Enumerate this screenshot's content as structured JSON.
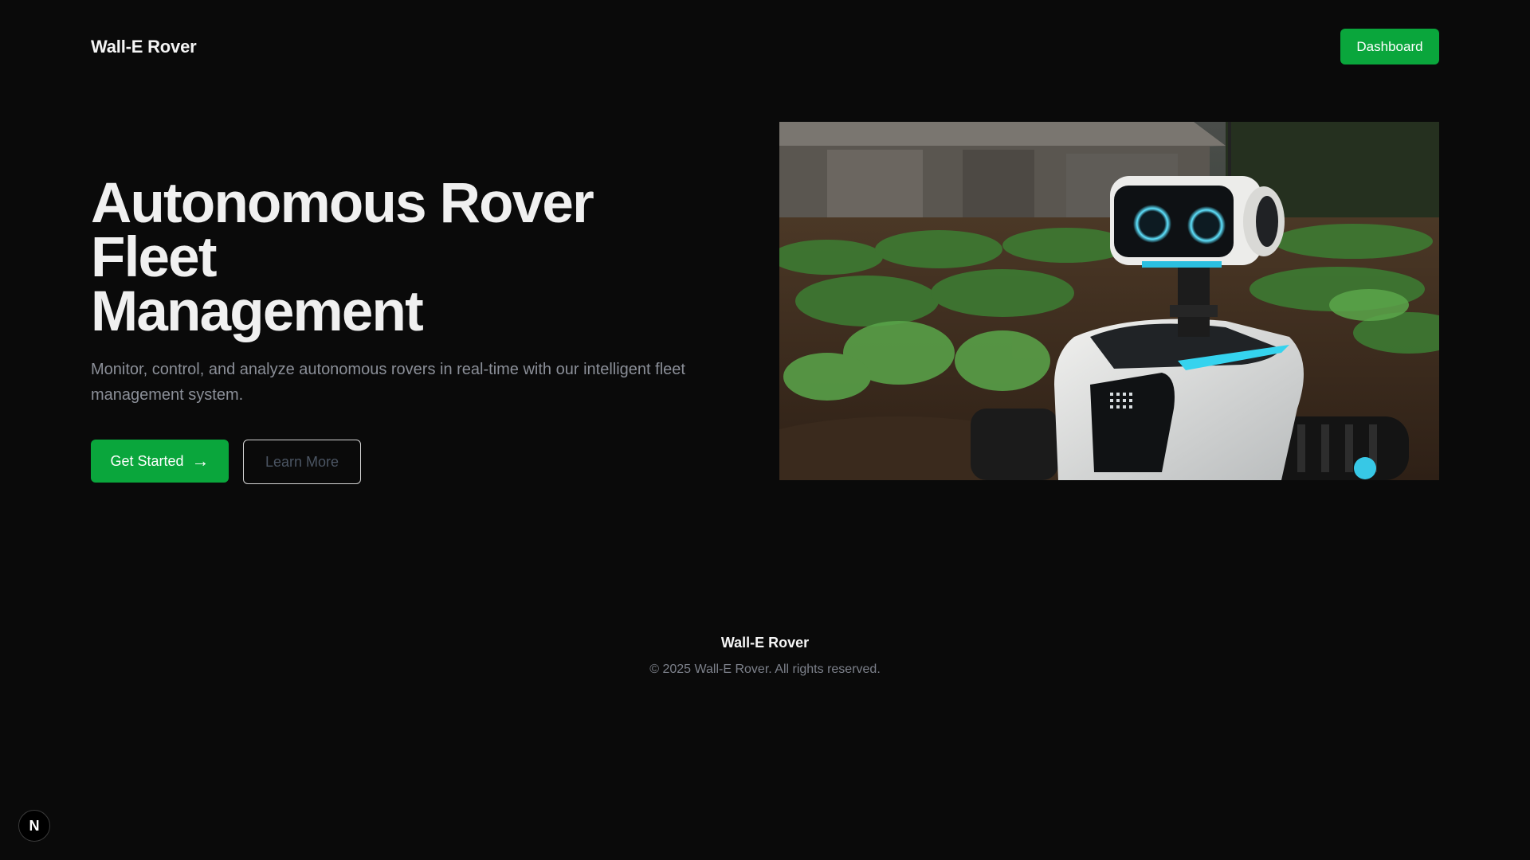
{
  "header": {
    "brand": "Wall-E Rover",
    "dashboard_label": "Dashboard"
  },
  "hero": {
    "title_line1": "Autonomous Rover Fleet",
    "title_line2": "Management",
    "subtitle": "Monitor, control, and analyze autonomous rovers in real-time with our intelligent fleet management system.",
    "primary_cta": "Get Started",
    "primary_cta_icon": "→",
    "secondary_cta": "Learn More"
  },
  "footer": {
    "brand": "Wall-E Rover",
    "copyright": "© 2025 Wall-E Rover. All rights reserved."
  },
  "next_badge": {
    "letter": "N"
  },
  "colors": {
    "background": "#0a0a0a",
    "accent": "#0aa63c",
    "muted_text": "#8b8f98"
  }
}
